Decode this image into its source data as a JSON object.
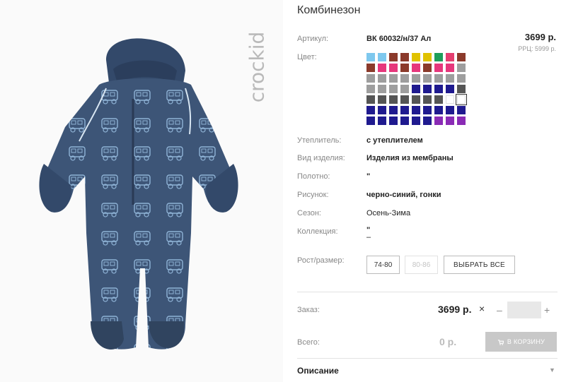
{
  "brand": {
    "logo_text": "crockid"
  },
  "product": {
    "title": "Комбинезон",
    "price": "3699 р.",
    "rrc": "РРЦ: 5999 р."
  },
  "specs": {
    "article_label": "Артикул:",
    "article_value": "ВК 60032/н/37 Ал",
    "color_label": "Цвет:",
    "insulation_label": "Утеплитель:",
    "insulation_value": "с утеплителем",
    "type_label": "Вид изделия:",
    "type_value": "Изделия из мембраны",
    "fabric_label": "Полотно:",
    "fabric_value": "\"",
    "pattern_label": "Рисунок:",
    "pattern_value": "черно-синий, гонки",
    "season_label": "Сезон:",
    "season_value": "Осень-Зима",
    "collection_label": "Коллекция:",
    "collection_value_1": "\"",
    "collection_value_2": "–"
  },
  "colors": [
    "#7ec8ee",
    "#7ec8ee",
    "#8b3a2b",
    "#8b3a2b",
    "#e0c200",
    "#e0c200",
    "#1e9e5a",
    "#e53e6f",
    "#8b3a2b",
    "#8b3a2b",
    "#e6377c",
    "#e6377c",
    "#8b3a2b",
    "#e6377c",
    "#8b3a2b",
    "#e6377c",
    "#e6377c",
    "#9e9e9e",
    "#9e9e9e",
    "#9e9e9e",
    "#9e9e9e",
    "#9e9e9e",
    "#9e9e9e",
    "#9e9e9e",
    "#9e9e9e",
    "#9e9e9e",
    "#9e9e9e",
    "#9e9e9e",
    "#9e9e9e",
    "#9e9e9e",
    "#9e9e9e",
    "#1f1a8f",
    "#1f1a8f",
    "#1f1a8f",
    "#1f1a8f",
    "#555555",
    "#555555",
    "#555555",
    "#555555",
    "#555555",
    "#555555",
    "#555555",
    "#555555",
    "empty",
    "selected",
    "#1f1a8f",
    "#1f1a8f",
    "#1f1a8f",
    "#1f1a8f",
    "#1f1a8f",
    "#1f1a8f",
    "#1f1a8f",
    "#1f1a8f",
    "#1f1a8f",
    "#1f1a8f",
    "#1f1a8f",
    "#1f1a8f",
    "#1f1a8f",
    "#1f1a8f",
    "#1f1a8f",
    "#8a2bb5",
    "#8a2bb5",
    "#8a2bb5"
  ],
  "sizes": {
    "label": "Рост/размер:",
    "options": [
      "74-80",
      "80-86"
    ],
    "select_all": "ВЫБРАТЬ ВСЕ"
  },
  "order": {
    "label": "Заказ:",
    "price": "3699 р.",
    "times": "×",
    "minus": "–",
    "plus": "+",
    "quantity": ""
  },
  "total": {
    "label": "Всего:",
    "value": "0 р.",
    "cart_button": "В КОРЗИНУ"
  },
  "description": {
    "label": "Описание",
    "chevron": "▼"
  }
}
